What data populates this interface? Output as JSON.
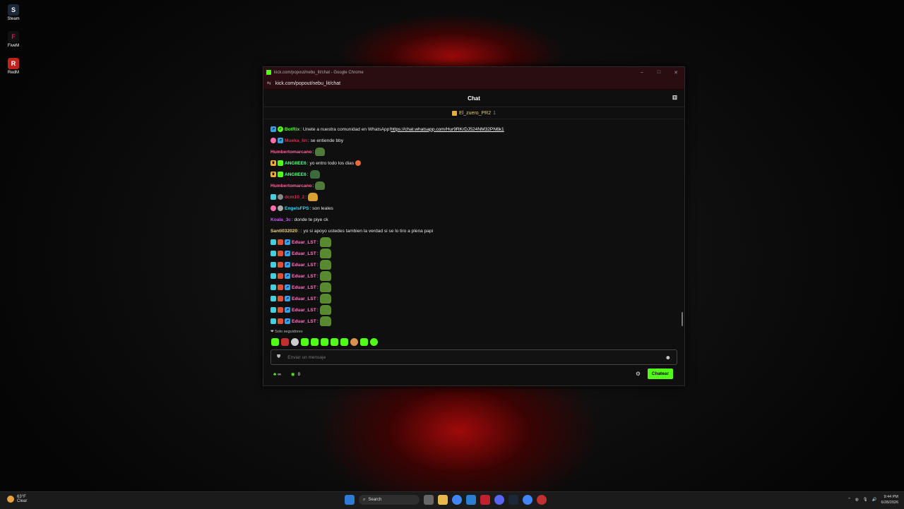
{
  "desktop": {
    "icons": [
      {
        "label": "Steam",
        "color": "#1b2838"
      },
      {
        "label": "FiveM",
        "color": "#f40552"
      },
      {
        "label": "RedM",
        "color": "#c0221c"
      }
    ]
  },
  "window": {
    "title": "kick.com/popout/nebu_lit/chat - Google Chrome",
    "url": "kick.com/popout/nebu_lit/chat"
  },
  "chat": {
    "header_title": "Chat",
    "pinned_user": "El_zuero_PR2",
    "pinned_count": "1",
    "messages": [
      {
        "user": "BotRix",
        "color": "#53fc18",
        "text": "Unete a nuestra comunidad en WhatsApp! ",
        "link": "https://chat.whatsapp.com/Hur9RKrDJ524NM32PN6k1"
      },
      {
        "user": "Mueka_lin",
        "color": "#e02850",
        "text": "se entiende bby"
      },
      {
        "user": "Humbertomarcano",
        "color": "#f06aa0",
        "text": ""
      },
      {
        "user": "ANGIIEE6",
        "color": "#5df58a",
        "text": "yo entro todo los dias"
      },
      {
        "user": "ANGIIEE6",
        "color": "#5df58a",
        "text": ""
      },
      {
        "user": "Humbertomarcano",
        "color": "#f06aa0",
        "text": ""
      },
      {
        "user": "dcm10_2",
        "color": "#e02850",
        "text": ""
      },
      {
        "user": "EngelsFPS",
        "color": "#36d3f0",
        "text": "son leales"
      },
      {
        "user": "Koala_3c",
        "color": "#c060f0",
        "text": "donde te piye ck"
      },
      {
        "user": "Santi032020",
        "color": "#f0d080",
        "text": ": yo si apoyo ustedes tambien la verdad si se lo tiro a plena papi"
      },
      {
        "user": "Eduar_LST",
        "color": "#ff77c8",
        "text": ""
      },
      {
        "user": "Eduar_LST",
        "color": "#ff77c8",
        "text": ""
      },
      {
        "user": "Eduar_LST",
        "color": "#ff77c8",
        "text": ""
      },
      {
        "user": "Eduar_LST",
        "color": "#ff77c8",
        "text": ""
      },
      {
        "user": "Eduar_LST",
        "color": "#ff77c8",
        "text": ""
      },
      {
        "user": "Eduar_LST",
        "color": "#ff77c8",
        "text": ""
      },
      {
        "user": "Eduar_LST",
        "color": "#ff77c8",
        "text": ""
      },
      {
        "user": "Eduar_LST",
        "color": "#ff77c8",
        "text": ""
      }
    ],
    "followers_only_label": "Solo seguidores",
    "input_placeholder": "Enviar un mensaje",
    "points": "∞",
    "viewers": "0",
    "send_label": "Chatear"
  },
  "taskbar": {
    "temperature": "63°F",
    "condition": "Clear",
    "search_label": "Search",
    "time": "9:44 PM",
    "date": "6/28/2026"
  }
}
